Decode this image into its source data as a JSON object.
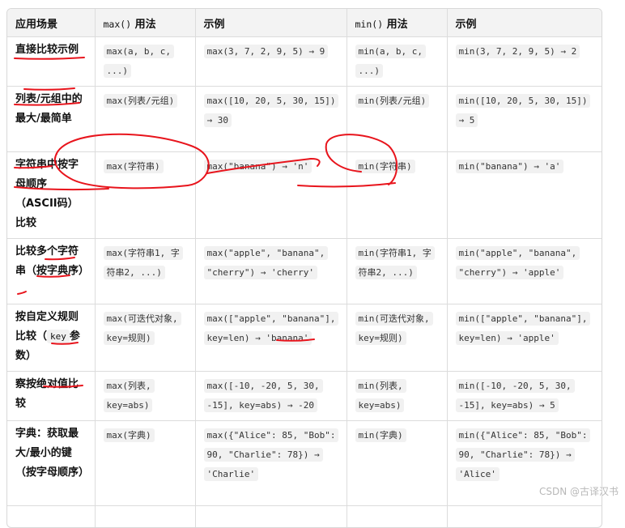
{
  "header": {
    "col1": "应用场景",
    "col2_code": "max()",
    "col2_text": " 用法",
    "col3": "示例",
    "col4_code": "min()",
    "col4_text": " 用法",
    "col5": "示例"
  },
  "rows": [
    {
      "scene": "直接比较示例",
      "max_usage": "max(a, b, c, ...)",
      "max_example": "max(3, 7, 2, 9, 5) → 9",
      "min_usage": "min(a, b, c, ...)",
      "min_example": "min(3, 7, 2, 9, 5) → 2"
    },
    {
      "scene": "列表/元组中的最大/最简单",
      "max_usage": "max(列表/元组)",
      "max_example": "max([10, 20, 5, 30, 15]) → 30",
      "min_usage": "min(列表/元组)",
      "min_example": "min([10, 20, 5, 30, 15]) → 5"
    },
    {
      "scene": "字符串中按字母顺序（ASCII码）比较",
      "max_usage": "max(字符串)",
      "max_example": "max(\"banana\") → 'n'",
      "min_usage": "min(字符串)",
      "min_example": "min(\"banana\") → 'a'"
    },
    {
      "scene": "比较多个字符串（按字典序）",
      "max_usage": "max(字符串1, 字符串2, ...)",
      "max_example": "max(\"apple\", \"banana\", \"cherry\") → 'cherry'",
      "min_usage": "min(字符串1, 字符串2, ...)",
      "min_example": "min(\"apple\", \"banana\", \"cherry\") → 'apple'"
    },
    {
      "scene_before": "按自定义规则比较（",
      "scene_code": "key",
      "scene_after": "参数）",
      "max_usage": "max(可迭代对象, key=规则)",
      "max_example": "max([\"apple\", \"banana\"], key=len) → 'banana'",
      "min_usage": "min(可迭代对象, key=规则)",
      "min_example": "min([\"apple\", \"banana\"], key=len) → 'apple'"
    },
    {
      "scene": "察按绝对值比较",
      "max_usage": "max(列表, key=abs)",
      "max_example": "max([-10, -20, 5, 30, -15], key=abs) → -20",
      "min_usage": "min(列表, key=abs)",
      "min_example": "min([-10, -20, 5, 30, -15], key=abs) → 5"
    },
    {
      "scene": "字典：获取最大/最小的键（按字母顺序）",
      "max_usage": "max(字典)",
      "max_example": "max({\"Alice\": 85, \"Bob\": 90, \"Charlie\": 78}) → 'Charlie'",
      "min_usage": "min(字典)",
      "min_example": "min({\"Alice\": 85, \"Bob\": 90, \"Charlie\": 78}) → 'Alice'"
    }
  ],
  "annotation_color": "#e8141c",
  "watermark": "CSDN @古译汉书"
}
